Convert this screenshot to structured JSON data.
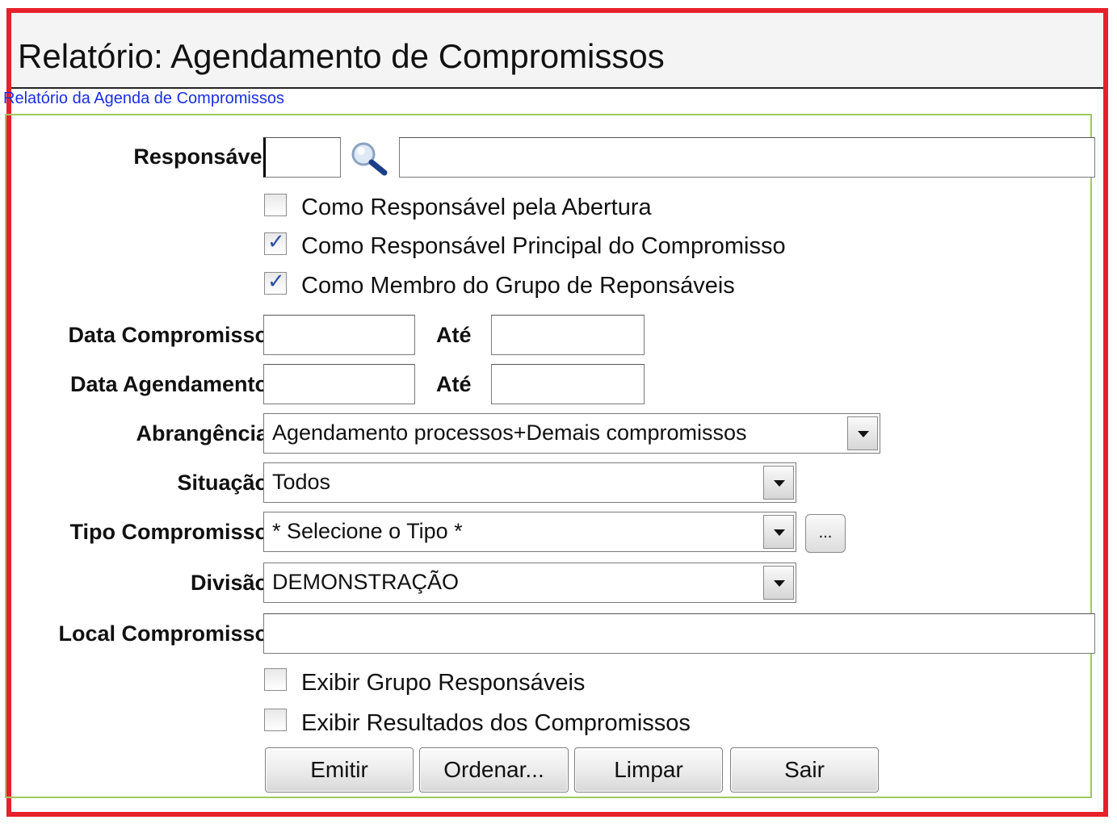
{
  "window": {
    "title": "Relatório: Agendamento de Compromissos",
    "subtitle": "Relatório da Agenda de Compromissos"
  },
  "form": {
    "responsavel": {
      "label": "Responsável",
      "code_value": "",
      "name_value": ""
    },
    "checkboxes_responsavel": [
      {
        "label": "Como Responsável pela Abertura",
        "checked": false
      },
      {
        "label": "Como Responsável Principal do Compromisso",
        "checked": true
      },
      {
        "label": "Como Membro do Grupo de Reponsáveis",
        "checked": true
      }
    ],
    "data_compromisso": {
      "label": "Data Compromisso",
      "from": "",
      "to_label": "Até",
      "to": ""
    },
    "data_agendamento": {
      "label": "Data Agendamento",
      "from": "",
      "to_label": "Até",
      "to": ""
    },
    "abrangencia": {
      "label": "Abrangência",
      "selected": "Agendamento processos+Demais compromissos"
    },
    "situacao": {
      "label": "Situação",
      "selected": "Todos"
    },
    "tipo_compromisso": {
      "label": "Tipo Compromisso",
      "selected": "* Selecione o Tipo *",
      "more_label": "..."
    },
    "divisao": {
      "label": "Divisão",
      "selected": "DEMONSTRAÇÃO"
    },
    "local_compromisso": {
      "label": "Local Compromisso",
      "value": ""
    },
    "checkboxes_exibir": [
      {
        "label": "Exibir Grupo Responsáveis",
        "checked": false
      },
      {
        "label": "Exibir Resultados dos Compromissos",
        "checked": false
      }
    ]
  },
  "buttons": {
    "emitir": "Emitir",
    "ordenar": "Ordenar...",
    "limpar": "Limpar",
    "sair": "Sair"
  },
  "icons": {
    "search": "search-icon"
  },
  "colors": {
    "frame_border": "#e8202a",
    "panel_border": "#9ccc5a",
    "subtitle_link": "#1a2fe0"
  }
}
